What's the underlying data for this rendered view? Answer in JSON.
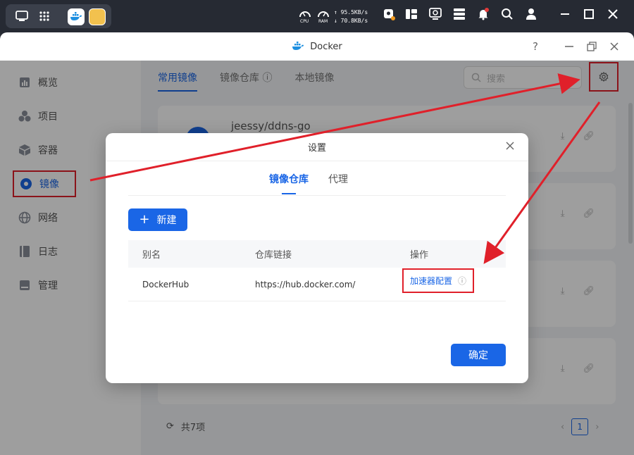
{
  "system_bar": {
    "cpu_label": "CPU",
    "ram_label": "RAM",
    "upload": "↑ 95.5KB/s",
    "download": "↓ 70.8KB/s"
  },
  "window": {
    "title": "Docker"
  },
  "sidebar": {
    "items": [
      {
        "label": "概览",
        "icon": "overview-icon"
      },
      {
        "label": "项目",
        "icon": "project-icon"
      },
      {
        "label": "容器",
        "icon": "container-icon"
      },
      {
        "label": "镜像",
        "icon": "image-icon"
      },
      {
        "label": "网络",
        "icon": "network-icon"
      },
      {
        "label": "日志",
        "icon": "log-icon"
      },
      {
        "label": "管理",
        "icon": "manage-icon"
      }
    ]
  },
  "main": {
    "tabs": [
      {
        "label": "常用镜像"
      },
      {
        "label": "镜像仓库"
      },
      {
        "label": "本地镜像"
      }
    ],
    "search_placeholder": "搜索",
    "first_card_title": "jeessy/ddns-go",
    "total": "共7项",
    "page": "1"
  },
  "dialog": {
    "title": "设置",
    "tabs": [
      {
        "label": "镜像仓库"
      },
      {
        "label": "代理"
      }
    ],
    "new_button": "新建",
    "columns": [
      "别名",
      "仓库链接",
      "操作"
    ],
    "rows": [
      {
        "alias": "DockerHub",
        "url": "https://hub.docker.com/",
        "action": "加速器配置"
      }
    ],
    "ok_button": "确定"
  },
  "colors": {
    "accent": "#1a66e6",
    "highlight": "#e0202a"
  }
}
